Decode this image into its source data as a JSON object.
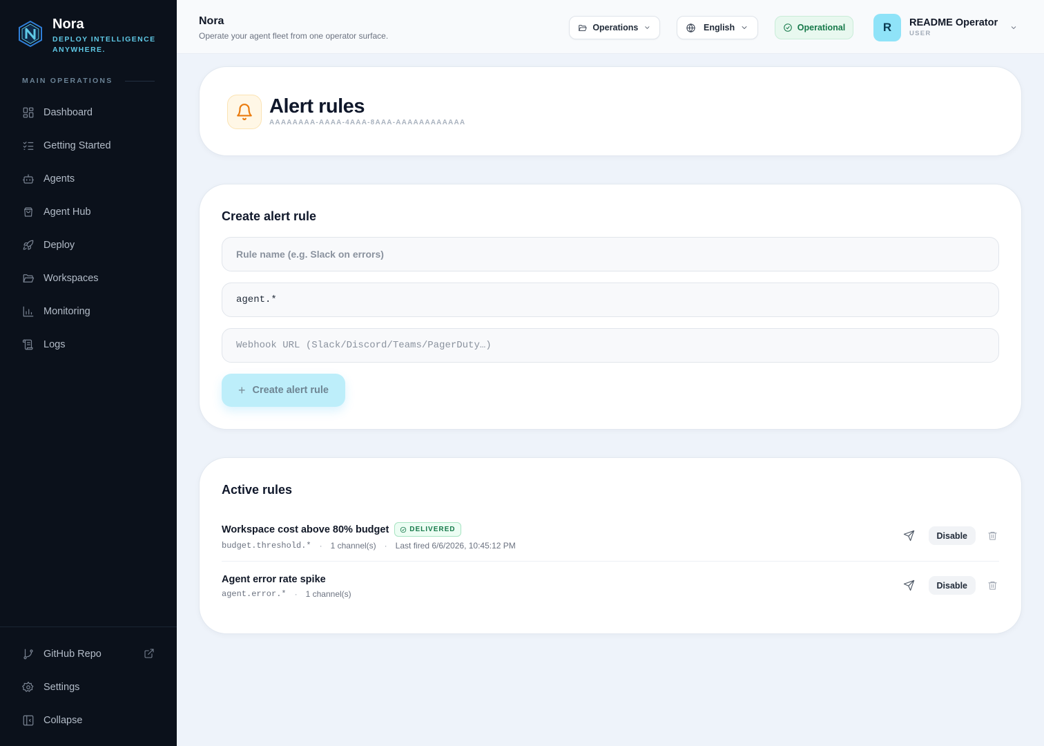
{
  "sidebar": {
    "brand_name": "Nora",
    "brand_tagline": "DEPLOY INTELLIGENCE ANYWHERE.",
    "section_label": "MAIN OPERATIONS",
    "items": [
      {
        "label": "Dashboard",
        "icon": "dashboard-icon"
      },
      {
        "label": "Getting Started",
        "icon": "checklist-icon"
      },
      {
        "label": "Agents",
        "icon": "bot-icon"
      },
      {
        "label": "Agent Hub",
        "icon": "shopping-bag-icon"
      },
      {
        "label": "Deploy",
        "icon": "rocket-icon"
      },
      {
        "label": "Workspaces",
        "icon": "folder-icon"
      },
      {
        "label": "Monitoring",
        "icon": "bar-chart-icon"
      },
      {
        "label": "Logs",
        "icon": "scroll-icon"
      }
    ],
    "bottom_items": [
      {
        "label": "GitHub Repo",
        "icon": "git-branch-icon"
      },
      {
        "label": "Settings",
        "icon": "gear-icon"
      },
      {
        "label": "Collapse",
        "icon": "collapse-icon"
      }
    ]
  },
  "topbar": {
    "title": "Nora",
    "subtitle": "Operate your agent fleet from one operator surface.",
    "workspace_select": "Operations",
    "language_select": "English",
    "status": "Operational",
    "user_initial": "R",
    "user_name": "README Operator",
    "user_role": "USER"
  },
  "header": {
    "title": "Alert rules",
    "id": "AAAAAAAA-AAAA-4AAA-8AAA-AAAAAAAAAAAA"
  },
  "create_form": {
    "heading": "Create alert rule",
    "name_placeholder": "Rule name (e.g. Slack on errors)",
    "pattern_value": "agent.*",
    "webhook_placeholder": "Webhook URL (Slack/Discord/Teams/PagerDuty…)",
    "submit_label": "Create alert rule"
  },
  "active_rules": {
    "heading": "Active rules",
    "rules": [
      {
        "name": "Workspace cost above 80% budget",
        "badge": "DELIVERED",
        "pattern": "budget.threshold.*",
        "channels": "1 channel(s)",
        "last_fired": "Last fired 6/6/2026, 10:45:12 PM",
        "disable_label": "Disable"
      },
      {
        "name": "Agent error rate spike",
        "pattern": "agent.error.*",
        "channels": "1 channel(s)",
        "disable_label": "Disable"
      }
    ]
  },
  "colors": {
    "sidebar_bg": "#0b111b",
    "accent": "#5fc9e6",
    "status_green": "#16794a",
    "bell_orange": "#ea7a0c"
  }
}
